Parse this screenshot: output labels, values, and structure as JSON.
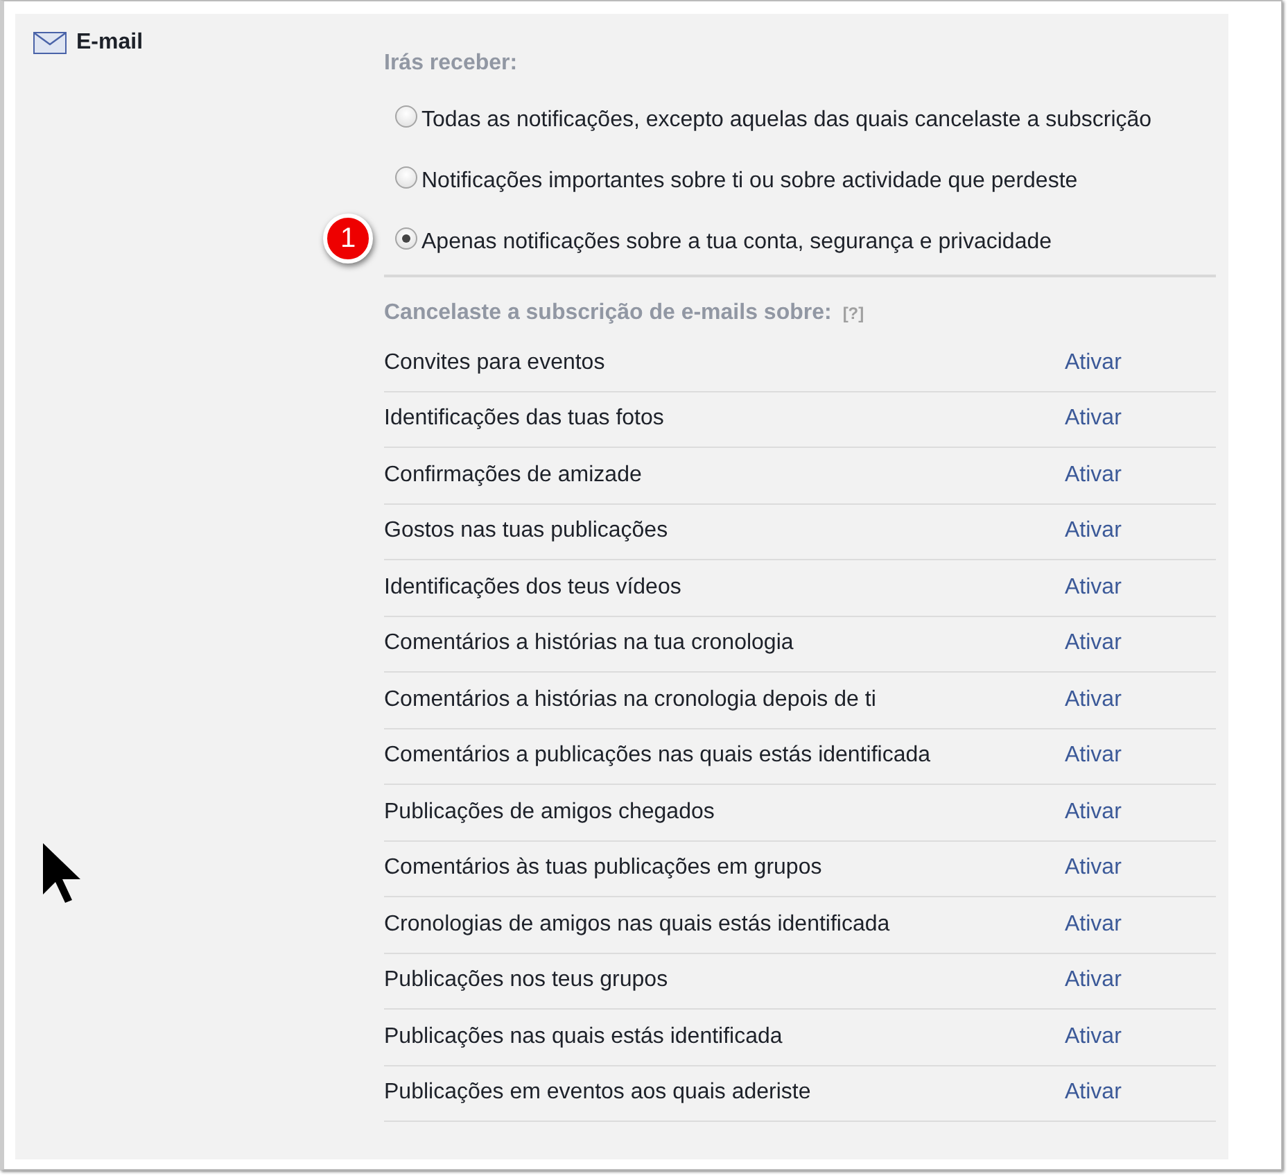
{
  "section": {
    "title": "E-mail"
  },
  "receive": {
    "heading": "Irás receber:",
    "options": [
      {
        "label": "Todas as notificações, excepto aquelas das quais cancelaste a subscrição",
        "selected": false
      },
      {
        "label": "Notificações importantes sobre ti ou sobre actividade que perdeste",
        "selected": false
      },
      {
        "label": "Apenas notificações sobre a tua conta, segurança e privacidade",
        "selected": true,
        "badge": "1"
      }
    ]
  },
  "unsubscribed": {
    "heading": "Cancelaste a subscrição de e-mails sobre:",
    "help": "[?]",
    "rows": [
      {
        "label": "Convites para eventos",
        "action": "Ativar"
      },
      {
        "label": "Identificações das tuas fotos",
        "action": "Ativar"
      },
      {
        "label": "Confirmações de amizade",
        "action": "Ativar"
      },
      {
        "label": "Gostos nas tuas publicações",
        "action": "Ativar"
      },
      {
        "label": "Identificações dos teus vídeos",
        "action": "Ativar"
      },
      {
        "label": "Comentários a histórias na tua cronologia",
        "action": "Ativar"
      },
      {
        "label": "Comentários a histórias na cronologia depois de ti",
        "action": "Ativar"
      },
      {
        "label": "Comentários a publicações nas quais estás identificada",
        "action": "Ativar"
      },
      {
        "label": "Publicações de amigos chegados",
        "action": "Ativar"
      },
      {
        "label": "Comentários às tuas publicações em grupos",
        "action": "Ativar"
      },
      {
        "label": "Cronologias de amigos nas quais estás identificada",
        "action": "Ativar"
      },
      {
        "label": "Publicações nos teus grupos",
        "action": "Ativar"
      },
      {
        "label": "Publicações nas quais estás identificada",
        "action": "Ativar"
      },
      {
        "label": "Publicações em eventos aos quais aderiste",
        "action": "Ativar"
      }
    ]
  }
}
